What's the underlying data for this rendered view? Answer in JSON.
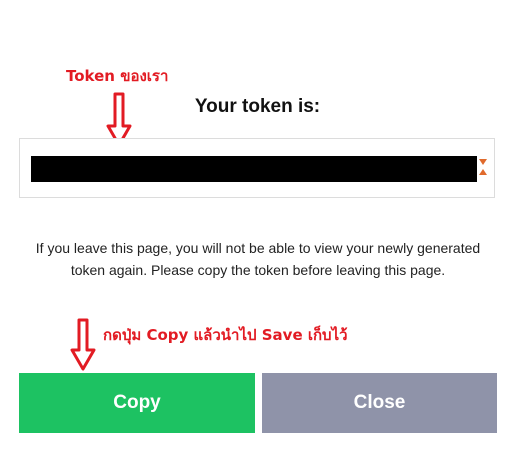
{
  "annotations": {
    "token_note": "Token ของเรา",
    "copy_note": "กดปุ่ม Copy แล้วนำไป Save เก็บไว้"
  },
  "dialog": {
    "title": "Your token is:",
    "notice": "If you leave this page, you will not be able to view your newly generated token again. Please copy the token before leaving this page.",
    "copy_label": "Copy",
    "close_label": "Close"
  },
  "colors": {
    "annotation": "#e21b23",
    "copy_button": "#1dc262",
    "close_button": "#8f93a9"
  }
}
